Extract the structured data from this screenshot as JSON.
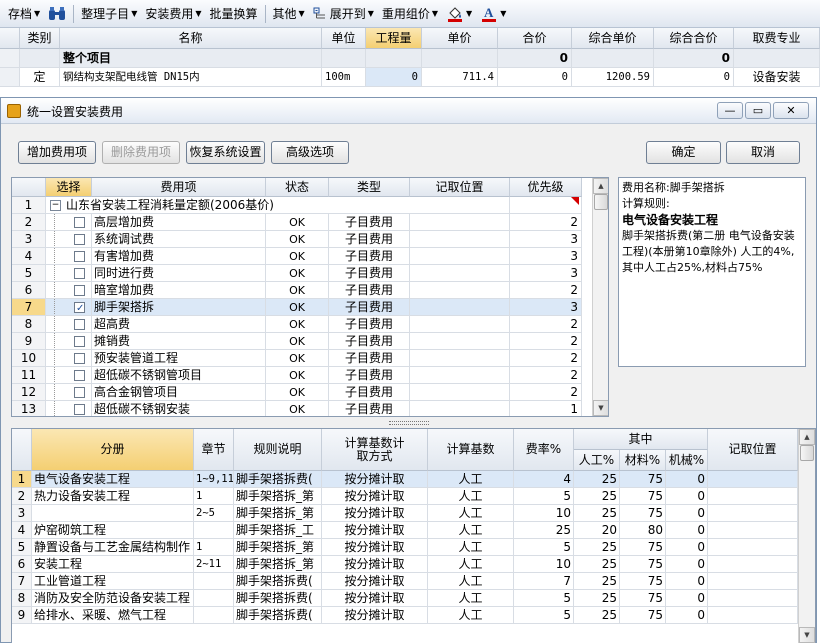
{
  "toolbar": {
    "items": [
      {
        "label": "存档",
        "arrow": true
      },
      {
        "label": "整理子目",
        "arrow": true
      },
      {
        "label": "安装费用",
        "arrow": true
      },
      {
        "label": "批量换算",
        "arrow": false
      },
      {
        "label": "其他",
        "arrow": true
      },
      {
        "label": "展开到",
        "arrow": true
      },
      {
        "label": "重用组价",
        "arrow": true
      }
    ]
  },
  "top_grid": {
    "headers": [
      "类别",
      "名称",
      "单位",
      "工程量",
      "单价",
      "合价",
      "综合单价",
      "综合合价",
      "取费专业"
    ],
    "summary_row": {
      "name": "整个项目",
      "total": "0",
      "composite_total": "0"
    },
    "item_row": {
      "category": "定",
      "name": "钢结构支架配电线管 DN15内",
      "unit": "100m",
      "quantity": "0",
      "unit_price": "711.4",
      "total": "0",
      "composite_price": "1200.59",
      "composite_total": "0",
      "specialty": "设备安装"
    }
  },
  "dialog": {
    "title": "统一设置安装费用",
    "buttons": {
      "add": "增加费用项",
      "delete": "删除费用项",
      "restore": "恢复系统设置",
      "advanced": "高级选项",
      "ok": "确定",
      "cancel": "取消"
    },
    "upper_grid": {
      "headers": [
        "选择",
        "费用项",
        "状态",
        "类型",
        "记取位置",
        "优先级"
      ],
      "group_title": "山东省安装工程消耗量定额(2006基价)",
      "rows": [
        {
          "num": "2",
          "name": "高层增加费",
          "checked": false,
          "status": "OK",
          "type": "子目费用",
          "priority": "2"
        },
        {
          "num": "3",
          "name": "系统调试费",
          "checked": false,
          "status": "OK",
          "type": "子目费用",
          "priority": "3"
        },
        {
          "num": "4",
          "name": "有害增加费",
          "checked": false,
          "status": "OK",
          "type": "子目费用",
          "priority": "3"
        },
        {
          "num": "5",
          "name": "同时进行费",
          "checked": false,
          "status": "OK",
          "type": "子目费用",
          "priority": "3"
        },
        {
          "num": "6",
          "name": "暗室增加费",
          "checked": false,
          "status": "OK",
          "type": "子目费用",
          "priority": "2"
        },
        {
          "num": "7",
          "name": "脚手架搭拆",
          "checked": true,
          "status": "OK",
          "type": "子目费用",
          "priority": "3"
        },
        {
          "num": "8",
          "name": "超高费",
          "checked": false,
          "status": "OK",
          "type": "子目费用",
          "priority": "2"
        },
        {
          "num": "9",
          "name": "摊销费",
          "checked": false,
          "status": "OK",
          "type": "子目费用",
          "priority": "2"
        },
        {
          "num": "10",
          "name": "预安装管道工程",
          "checked": false,
          "status": "OK",
          "type": "子目费用",
          "priority": "2"
        },
        {
          "num": "11",
          "name": "超低碳不锈钢管项目",
          "checked": false,
          "status": "OK",
          "type": "子目费用",
          "priority": "2"
        },
        {
          "num": "12",
          "name": "高合金钢管项目",
          "checked": false,
          "status": "OK",
          "type": "子目费用",
          "priority": "2"
        },
        {
          "num": "13",
          "name": "超低碳不锈钢安装",
          "checked": false,
          "status": "OK",
          "type": "子目费用",
          "priority": "1"
        }
      ]
    },
    "info_panel": {
      "fee_name": "费用名称:脚手架搭拆",
      "rule_label": "计算规则:",
      "section": "电气设备安装工程",
      "description": "脚手架搭拆费(第二册 电气设备安装工程)(本册第10章除外) 人工的4%, 其中人工占25%,材料占75%"
    },
    "lower_grid": {
      "headers": {
        "division": "分册",
        "chapter": "章节",
        "rule": "规则说明",
        "method": "计算基数计取方式",
        "base": "计算基数",
        "rate": "费率%",
        "of_which": "其中",
        "labor": "人工%",
        "material": "材料%",
        "machine": "机械%",
        "position": "记取位置"
      },
      "rows": [
        {
          "num": "1",
          "division": "电气设备安装工程",
          "chapter": "1~9,11",
          "rule": "脚手架搭拆费(",
          "method": "按分摊计取",
          "base": "人工",
          "rate": "4",
          "labor": "25",
          "material": "75",
          "machine": "0"
        },
        {
          "num": "2",
          "division": "热力设备安装工程",
          "chapter": "1",
          "rule": "脚手架搭拆_第",
          "method": "按分摊计取",
          "base": "人工",
          "rate": "5",
          "labor": "25",
          "material": "75",
          "machine": "0"
        },
        {
          "num": "3",
          "division": "",
          "chapter": "2~5",
          "rule": "脚手架搭拆_第",
          "method": "按分摊计取",
          "base": "人工",
          "rate": "10",
          "labor": "25",
          "material": "75",
          "machine": "0"
        },
        {
          "num": "4",
          "division": "炉窑砌筑工程",
          "chapter": "",
          "rule": "脚手架搭拆_工",
          "method": "按分摊计取",
          "base": "人工",
          "rate": "25",
          "labor": "20",
          "material": "80",
          "machine": "0"
        },
        {
          "num": "5",
          "division": "静置设备与工艺金属结构制作",
          "chapter": "1",
          "rule": "脚手架搭拆_第",
          "method": "按分摊计取",
          "base": "人工",
          "rate": "5",
          "labor": "25",
          "material": "75",
          "machine": "0"
        },
        {
          "num": "6",
          "division": "安装工程",
          "chapter": "2~11",
          "rule": "脚手架搭拆_第",
          "method": "按分摊计取",
          "base": "人工",
          "rate": "10",
          "labor": "25",
          "material": "75",
          "machine": "0"
        },
        {
          "num": "7",
          "division": "工业管道工程",
          "chapter": "",
          "rule": "脚手架搭拆费(",
          "method": "按分摊计取",
          "base": "人工",
          "rate": "7",
          "labor": "25",
          "material": "75",
          "machine": "0"
        },
        {
          "num": "8",
          "division": "消防及安全防范设备安装工程",
          "chapter": "",
          "rule": "脚手架搭拆费(",
          "method": "按分摊计取",
          "base": "人工",
          "rate": "5",
          "labor": "25",
          "material": "75",
          "machine": "0"
        },
        {
          "num": "9",
          "division": "给排水、采暖、燃气工程",
          "chapter": "",
          "rule": "脚手架搭拆费(",
          "method": "按分摊计取",
          "base": "人工",
          "rate": "5",
          "labor": "25",
          "material": "75",
          "machine": "0"
        }
      ]
    }
  },
  "colors": {
    "accent": "#f7d98b",
    "selected_row": "#dbe8f7",
    "icon_blue": "#1f4f9c",
    "font_red": "#d40000"
  }
}
